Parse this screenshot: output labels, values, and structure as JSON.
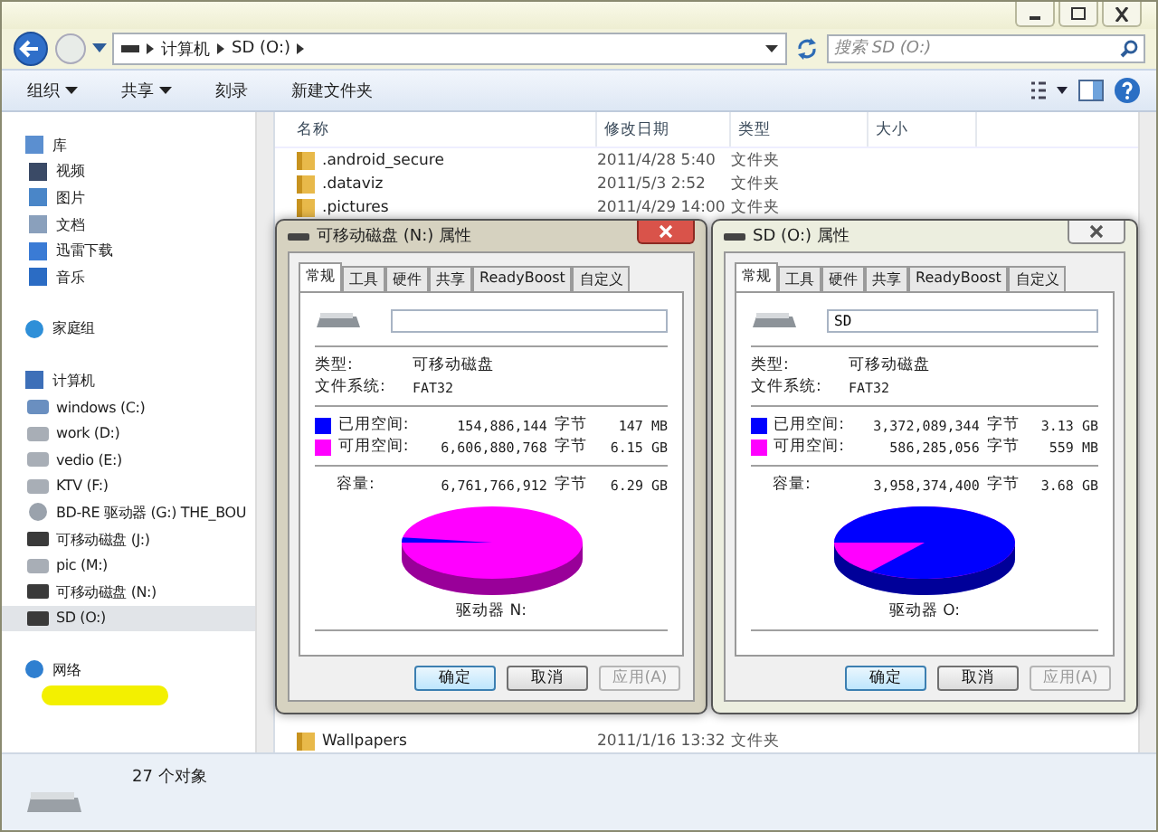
{
  "address": {
    "crumbs": [
      "计算机",
      "SD (O:)"
    ],
    "search_placeholder": "搜索 SD (O:)"
  },
  "toolbar": {
    "buttons": [
      {
        "label": "组织",
        "dropdown": true
      },
      {
        "label": "共享",
        "dropdown": true
      },
      {
        "label": "刻录",
        "dropdown": false
      },
      {
        "label": "新建文件夹",
        "dropdown": false
      }
    ]
  },
  "sidebar": {
    "items": [
      {
        "label": "库",
        "kind": "library",
        "selected": false,
        "children": [
          {
            "label": "视频",
            "kind": "video",
            "selected": false
          },
          {
            "label": "图片",
            "kind": "pictures",
            "selected": false
          },
          {
            "label": "文档",
            "kind": "documents",
            "selected": false
          },
          {
            "label": "迅雷下载",
            "kind": "download",
            "selected": false
          },
          {
            "label": "音乐",
            "kind": "music",
            "selected": false
          }
        ]
      },
      {
        "label": "家庭组",
        "kind": "homegroup",
        "selected": false
      },
      {
        "label": "计算机",
        "kind": "computer",
        "selected": false,
        "children": [
          {
            "label": "windows (C:)",
            "kind": "system-drive",
            "selected": false
          },
          {
            "label": "work (D:)",
            "kind": "disk",
            "selected": false
          },
          {
            "label": "vedio (E:)",
            "kind": "disk",
            "selected": false
          },
          {
            "label": "KTV (F:)",
            "kind": "disk",
            "selected": false
          },
          {
            "label": "BD-RE 驱动器 (G:) THE_BOU",
            "kind": "optical",
            "selected": false
          },
          {
            "label": "可移动磁盘 (J:)",
            "kind": "removable",
            "selected": false
          },
          {
            "label": "pic (M:)",
            "kind": "disk",
            "selected": false
          },
          {
            "label": "可移动磁盘 (N:)",
            "kind": "removable",
            "selected": false
          },
          {
            "label": "SD (O:)",
            "kind": "removable",
            "selected": true
          }
        ]
      },
      {
        "label": "网络",
        "kind": "network",
        "selected": false,
        "children": [
          {
            "kind": "redacted",
            "selected": false
          }
        ]
      }
    ]
  },
  "files": {
    "columns": [
      "名称",
      "修改日期",
      "类型",
      "大小"
    ],
    "rows": [
      {
        "name": ".android_secure",
        "date": "2011/4/28 5:40",
        "type": "文件夹"
      },
      {
        "name": ".dataviz",
        "date": "2011/5/3 2:52",
        "type": "文件夹"
      },
      {
        "name": ".pictures",
        "date": "2011/4/29 14:00",
        "type": "文件夹"
      },
      {
        "name": "Wallpapers",
        "date": "2011/1/16 13:32",
        "type": "文件夹"
      }
    ]
  },
  "status_bar": {
    "text": "27 个对象"
  },
  "dialogs": [
    {
      "title": "可移动磁盘 (N:) 属性",
      "active": true,
      "tabs": [
        {
          "label": "常规",
          "selected": true
        },
        {
          "label": "工具",
          "selected": false
        },
        {
          "label": "硬件",
          "selected": false
        },
        {
          "label": "共享",
          "selected": false
        },
        {
          "label": "ReadyBoost",
          "selected": false
        },
        {
          "label": "自定义",
          "selected": false
        }
      ],
      "type_label": "类型:",
      "type_value": "可移动磁盘",
      "fs_label": "文件系统:",
      "fs_value": "FAT32",
      "space": [
        {
          "label": "已用空间:",
          "bytes": "154,886,144",
          "unit": "字节",
          "size": "147 MB",
          "color": "#0000ff"
        },
        {
          "label": "可用空间:",
          "bytes": "6,606,880,768",
          "unit": "字节",
          "size": "6.15 GB",
          "color": "#ff00ff"
        }
      ],
      "capacity": {
        "label": "容量:",
        "bytes": "6,761,766,912",
        "unit": "字节",
        "size": "6.29 GB"
      },
      "drive_label": "驱动器 N:",
      "buttons": [
        {
          "label": "确定",
          "default": true,
          "disabled": false
        },
        {
          "label": "取消",
          "default": false,
          "disabled": false
        },
        {
          "label": "应用(A)",
          "default": false,
          "disabled": true
        }
      ]
    },
    {
      "title": "SD (O:) 属性",
      "active": false,
      "name_value": "SD",
      "tabs": [
        {
          "label": "常规",
          "selected": true
        },
        {
          "label": "工具",
          "selected": false
        },
        {
          "label": "硬件",
          "selected": false
        },
        {
          "label": "共享",
          "selected": false
        },
        {
          "label": "ReadyBoost",
          "selected": false
        },
        {
          "label": "自定义",
          "selected": false
        }
      ],
      "type_label": "类型:",
      "type_value": "可移动磁盘",
      "fs_label": "文件系统:",
      "fs_value": "FAT32",
      "space": [
        {
          "label": "已用空间:",
          "bytes": "3,372,089,344",
          "unit": "字节",
          "size": "3.13 GB",
          "color": "#0000ff"
        },
        {
          "label": "可用空间:",
          "bytes": "586,285,056",
          "unit": "字节",
          "size": "559 MB",
          "color": "#ff00ff"
        }
      ],
      "capacity": {
        "label": "容量:",
        "bytes": "3,958,374,400",
        "unit": "字节",
        "size": "3.68 GB"
      },
      "drive_label": "驱动器 O:",
      "buttons": [
        {
          "label": "确定",
          "default": true,
          "disabled": false
        },
        {
          "label": "取消",
          "default": false,
          "disabled": false
        },
        {
          "label": "应用(A)",
          "default": false,
          "disabled": true
        }
      ]
    }
  ]
}
